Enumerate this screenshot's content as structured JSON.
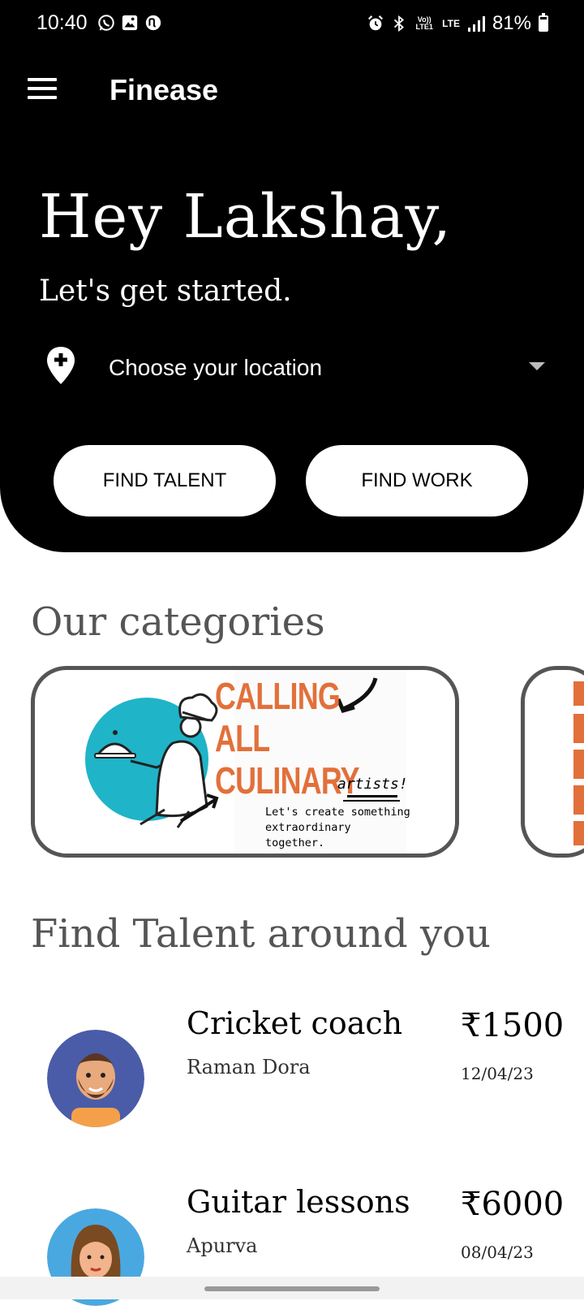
{
  "status_bar": {
    "time": "10:40",
    "battery": "81%",
    "battery_level": 0.81,
    "left_icons": [
      "whatsapp-icon",
      "gallery-icon",
      "sync-icon"
    ],
    "right_icons": [
      "alarm-icon",
      "bluetooth-icon",
      "volte-icon",
      "lte-icon",
      "signal-icon",
      "battery-icon"
    ],
    "volte_label": "Vo)) LTE1",
    "lte_label": "LTE"
  },
  "app_bar": {
    "title": "Finease",
    "menu_icon": "hamburger-menu-icon"
  },
  "hero": {
    "greeting": "Hey Lakshay,",
    "subtitle": "Let's get started.",
    "location_placeholder": "Choose your location",
    "find_talent": "FIND TALENT",
    "find_work": "FIND WORK"
  },
  "categories": {
    "title": "Our categories",
    "cards": [
      {
        "headline": [
          "CALLING",
          "ALL",
          "CULINARY"
        ],
        "script": "artists!",
        "tagline": [
          "Let's create something",
          "extraordinary",
          "together."
        ]
      }
    ]
  },
  "talent": {
    "title": "Find Talent around you",
    "items": [
      {
        "title": "Cricket coach",
        "name": "Raman Dora",
        "price": "₹1500",
        "date": "12/04/23"
      },
      {
        "title": "Guitar lessons",
        "name": "Apurva",
        "price": "₹6000",
        "date": "08/04/23"
      }
    ]
  },
  "colors": {
    "hero_bg": "#000000",
    "accent_orange": "#e2703a",
    "teal_circle": "#1fb4c8",
    "card_border": "#555555"
  }
}
